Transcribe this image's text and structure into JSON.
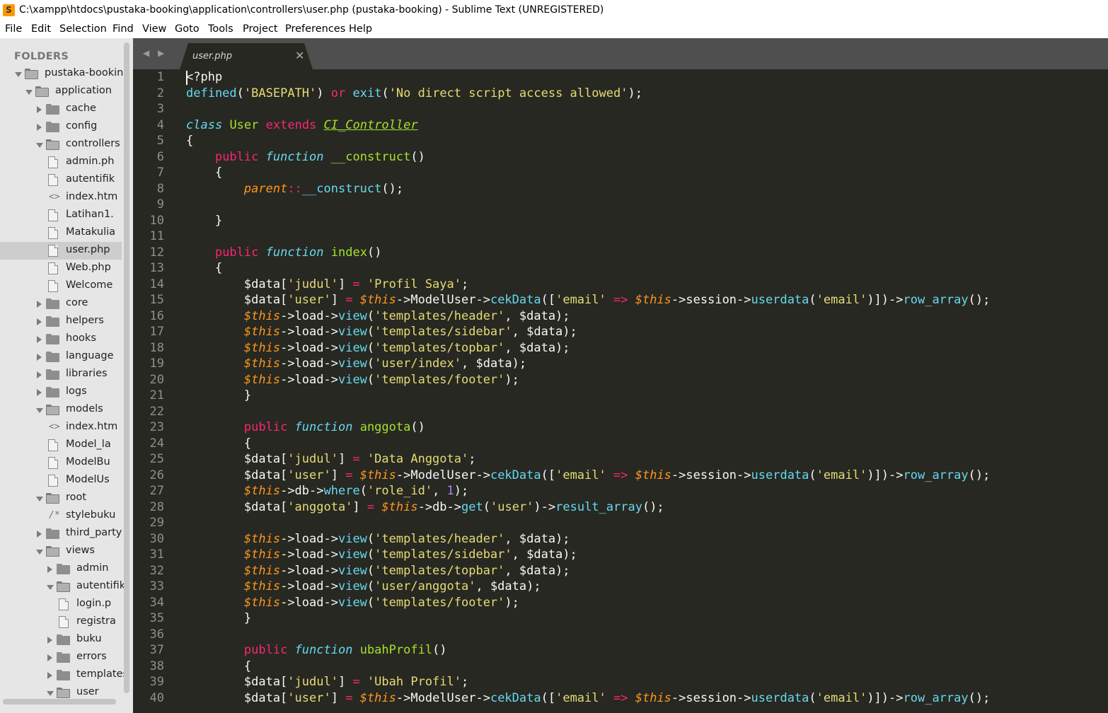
{
  "window": {
    "title": "C:\\xampp\\htdocs\\pustaka-booking\\application\\controllers\\user.php (pustaka-booking) - Sublime Text (UNREGISTERED)"
  },
  "menu": [
    "File",
    "Edit",
    "Selection",
    "Find",
    "View",
    "Goto",
    "Tools",
    "Project",
    "Preferences",
    "Help"
  ],
  "sidebar": {
    "header": "FOLDERS",
    "tree": [
      {
        "label": "pustaka-booking",
        "type": "folder",
        "expanded": true,
        "depth": 0
      },
      {
        "label": "application",
        "type": "folder",
        "expanded": true,
        "depth": 1
      },
      {
        "label": "cache",
        "type": "folder",
        "expanded": false,
        "depth": 2
      },
      {
        "label": "config",
        "type": "folder",
        "expanded": false,
        "depth": 2
      },
      {
        "label": "controllers",
        "type": "folder",
        "expanded": true,
        "depth": 2
      },
      {
        "label": "admin.ph",
        "type": "file",
        "depth": 3
      },
      {
        "label": "autentifik",
        "type": "file",
        "depth": 3
      },
      {
        "label": "index.htm",
        "type": "html",
        "depth": 3
      },
      {
        "label": "Latihan1.",
        "type": "file",
        "depth": 3
      },
      {
        "label": "Matakulia",
        "type": "file",
        "depth": 3
      },
      {
        "label": "user.php",
        "type": "file",
        "depth": 3,
        "selected": true
      },
      {
        "label": "Web.php",
        "type": "file",
        "depth": 3
      },
      {
        "label": "Welcome",
        "type": "file",
        "depth": 3
      },
      {
        "label": "core",
        "type": "folder",
        "expanded": false,
        "depth": 2
      },
      {
        "label": "helpers",
        "type": "folder",
        "expanded": false,
        "depth": 2
      },
      {
        "label": "hooks",
        "type": "folder",
        "expanded": false,
        "depth": 2
      },
      {
        "label": "language",
        "type": "folder",
        "expanded": false,
        "depth": 2
      },
      {
        "label": "libraries",
        "type": "folder",
        "expanded": false,
        "depth": 2
      },
      {
        "label": "logs",
        "type": "folder",
        "expanded": false,
        "depth": 2
      },
      {
        "label": "models",
        "type": "folder",
        "expanded": true,
        "depth": 2
      },
      {
        "label": "index.htm",
        "type": "html",
        "depth": 3
      },
      {
        "label": "Model_la",
        "type": "file",
        "depth": 3
      },
      {
        "label": "ModelBu",
        "type": "file",
        "depth": 3
      },
      {
        "label": "ModelUs",
        "type": "file",
        "depth": 3
      },
      {
        "label": "root",
        "type": "folder",
        "expanded": true,
        "depth": 2
      },
      {
        "label": "stylebuku",
        "type": "css",
        "depth": 3
      },
      {
        "label": "third_party",
        "type": "folder",
        "expanded": false,
        "depth": 2
      },
      {
        "label": "views",
        "type": "folder",
        "expanded": true,
        "depth": 2
      },
      {
        "label": "admin",
        "type": "folder",
        "expanded": false,
        "depth": 3
      },
      {
        "label": "autentifik",
        "type": "folder",
        "expanded": true,
        "depth": 3
      },
      {
        "label": "login.p",
        "type": "file",
        "depth": 4
      },
      {
        "label": "registra",
        "type": "file",
        "depth": 4
      },
      {
        "label": "buku",
        "type": "folder",
        "expanded": false,
        "depth": 3
      },
      {
        "label": "errors",
        "type": "folder",
        "expanded": false,
        "depth": 3
      },
      {
        "label": "templates",
        "type": "folder",
        "expanded": false,
        "depth": 3
      },
      {
        "label": "user",
        "type": "folder",
        "expanded": true,
        "depth": 3
      }
    ]
  },
  "tabs": [
    {
      "label": "user.php",
      "active": true
    }
  ],
  "editor": {
    "lines": [
      [
        [
          "p",
          "<?php"
        ]
      ],
      [
        [
          "f",
          "defined"
        ],
        [
          "p",
          "("
        ],
        [
          "s",
          "'BASEPATH'"
        ],
        [
          "p",
          ") "
        ],
        [
          "k",
          "or"
        ],
        [
          "p",
          " "
        ],
        [
          "f",
          "exit"
        ],
        [
          "p",
          "("
        ],
        [
          "s",
          "'No direct script access allowed'"
        ],
        [
          "p",
          ");"
        ]
      ],
      [],
      [
        [
          "sk",
          "class"
        ],
        [
          "p",
          " "
        ],
        [
          "cls",
          "User"
        ],
        [
          "p",
          " "
        ],
        [
          "k",
          "extends"
        ],
        [
          "p",
          " "
        ],
        [
          "inh",
          "CI_Controller"
        ]
      ],
      [
        [
          "p",
          "{"
        ]
      ],
      [
        [
          "p",
          "    "
        ],
        [
          "k",
          "public"
        ],
        [
          "p",
          " "
        ],
        [
          "sk",
          "function"
        ],
        [
          "p",
          " "
        ],
        [
          "cls",
          "__construct"
        ],
        [
          "p",
          "()"
        ]
      ],
      [
        [
          "p",
          "    {"
        ]
      ],
      [
        [
          "p",
          "        "
        ],
        [
          "v",
          "parent"
        ],
        [
          "k",
          "::"
        ],
        [
          "f",
          "__construct"
        ],
        [
          "p",
          "();"
        ]
      ],
      [],
      [
        [
          "p",
          "    }"
        ]
      ],
      [],
      [
        [
          "p",
          "    "
        ],
        [
          "k",
          "public"
        ],
        [
          "p",
          " "
        ],
        [
          "sk",
          "function"
        ],
        [
          "p",
          " "
        ],
        [
          "cls",
          "index"
        ],
        [
          "p",
          "()"
        ]
      ],
      [
        [
          "p",
          "    {"
        ]
      ],
      [
        [
          "p",
          "        $data["
        ],
        [
          "s",
          "'judul'"
        ],
        [
          "p",
          "] "
        ],
        [
          "k",
          "="
        ],
        [
          "p",
          " "
        ],
        [
          "s",
          "'Profil Saya'"
        ],
        [
          "p",
          ";"
        ]
      ],
      [
        [
          "p",
          "        $data["
        ],
        [
          "s",
          "'user'"
        ],
        [
          "p",
          "] "
        ],
        [
          "k",
          "="
        ],
        [
          "p",
          " "
        ],
        [
          "v",
          "$this"
        ],
        [
          "p",
          "->ModelUser->"
        ],
        [
          "f",
          "cekData"
        ],
        [
          "p",
          "(["
        ],
        [
          "s",
          "'email'"
        ],
        [
          "p",
          " "
        ],
        [
          "k",
          "=>"
        ],
        [
          "p",
          " "
        ],
        [
          "v",
          "$this"
        ],
        [
          "p",
          "->session->"
        ],
        [
          "f",
          "userdata"
        ],
        [
          "p",
          "("
        ],
        [
          "s",
          "'email'"
        ],
        [
          "p",
          ")])->"
        ],
        [
          "f",
          "row_array"
        ],
        [
          "p",
          "();"
        ]
      ],
      [
        [
          "p",
          "        "
        ],
        [
          "v",
          "$this"
        ],
        [
          "p",
          "->load->"
        ],
        [
          "f",
          "view"
        ],
        [
          "p",
          "("
        ],
        [
          "s",
          "'templates/header'"
        ],
        [
          "p",
          ", $data);"
        ]
      ],
      [
        [
          "p",
          "        "
        ],
        [
          "v",
          "$this"
        ],
        [
          "p",
          "->load->"
        ],
        [
          "f",
          "view"
        ],
        [
          "p",
          "("
        ],
        [
          "s",
          "'templates/sidebar'"
        ],
        [
          "p",
          ", $data);"
        ]
      ],
      [
        [
          "p",
          "        "
        ],
        [
          "v",
          "$this"
        ],
        [
          "p",
          "->load->"
        ],
        [
          "f",
          "view"
        ],
        [
          "p",
          "("
        ],
        [
          "s",
          "'templates/topbar'"
        ],
        [
          "p",
          ", $data);"
        ]
      ],
      [
        [
          "p",
          "        "
        ],
        [
          "v",
          "$this"
        ],
        [
          "p",
          "->load->"
        ],
        [
          "f",
          "view"
        ],
        [
          "p",
          "("
        ],
        [
          "s",
          "'user/index'"
        ],
        [
          "p",
          ", $data);"
        ]
      ],
      [
        [
          "p",
          "        "
        ],
        [
          "v",
          "$this"
        ],
        [
          "p",
          "->load->"
        ],
        [
          "f",
          "view"
        ],
        [
          "p",
          "("
        ],
        [
          "s",
          "'templates/footer'"
        ],
        [
          "p",
          ");"
        ]
      ],
      [
        [
          "p",
          "        }"
        ]
      ],
      [],
      [
        [
          "p",
          "        "
        ],
        [
          "k",
          "public"
        ],
        [
          "p",
          " "
        ],
        [
          "sk",
          "function"
        ],
        [
          "p",
          " "
        ],
        [
          "cls",
          "anggota"
        ],
        [
          "p",
          "()"
        ]
      ],
      [
        [
          "p",
          "        {"
        ]
      ],
      [
        [
          "p",
          "        $data["
        ],
        [
          "s",
          "'judul'"
        ],
        [
          "p",
          "] "
        ],
        [
          "k",
          "="
        ],
        [
          "p",
          " "
        ],
        [
          "s",
          "'Data Anggota'"
        ],
        [
          "p",
          ";"
        ]
      ],
      [
        [
          "p",
          "        $data["
        ],
        [
          "s",
          "'user'"
        ],
        [
          "p",
          "] "
        ],
        [
          "k",
          "="
        ],
        [
          "p",
          " "
        ],
        [
          "v",
          "$this"
        ],
        [
          "p",
          "->ModelUser->"
        ],
        [
          "f",
          "cekData"
        ],
        [
          "p",
          "(["
        ],
        [
          "s",
          "'email'"
        ],
        [
          "p",
          " "
        ],
        [
          "k",
          "=>"
        ],
        [
          "p",
          " "
        ],
        [
          "v",
          "$this"
        ],
        [
          "p",
          "->session->"
        ],
        [
          "f",
          "userdata"
        ],
        [
          "p",
          "("
        ],
        [
          "s",
          "'email'"
        ],
        [
          "p",
          ")])->"
        ],
        [
          "f",
          "row_array"
        ],
        [
          "p",
          "();"
        ]
      ],
      [
        [
          "p",
          "        "
        ],
        [
          "v",
          "$this"
        ],
        [
          "p",
          "->db->"
        ],
        [
          "f",
          "where"
        ],
        [
          "p",
          "("
        ],
        [
          "s",
          "'role_id'"
        ],
        [
          "p",
          ", "
        ],
        [
          "n",
          "1"
        ],
        [
          "p",
          ");"
        ]
      ],
      [
        [
          "p",
          "        $data["
        ],
        [
          "s",
          "'anggota'"
        ],
        [
          "p",
          "] "
        ],
        [
          "k",
          "="
        ],
        [
          "p",
          " "
        ],
        [
          "v",
          "$this"
        ],
        [
          "p",
          "->db->"
        ],
        [
          "f",
          "get"
        ],
        [
          "p",
          "("
        ],
        [
          "s",
          "'user'"
        ],
        [
          "p",
          ")->"
        ],
        [
          "f",
          "result_array"
        ],
        [
          "p",
          "();"
        ]
      ],
      [],
      [
        [
          "p",
          "        "
        ],
        [
          "v",
          "$this"
        ],
        [
          "p",
          "->load->"
        ],
        [
          "f",
          "view"
        ],
        [
          "p",
          "("
        ],
        [
          "s",
          "'templates/header'"
        ],
        [
          "p",
          ", $data);"
        ]
      ],
      [
        [
          "p",
          "        "
        ],
        [
          "v",
          "$this"
        ],
        [
          "p",
          "->load->"
        ],
        [
          "f",
          "view"
        ],
        [
          "p",
          "("
        ],
        [
          "s",
          "'templates/sidebar'"
        ],
        [
          "p",
          ", $data);"
        ]
      ],
      [
        [
          "p",
          "        "
        ],
        [
          "v",
          "$this"
        ],
        [
          "p",
          "->load->"
        ],
        [
          "f",
          "view"
        ],
        [
          "p",
          "("
        ],
        [
          "s",
          "'templates/topbar'"
        ],
        [
          "p",
          ", $data);"
        ]
      ],
      [
        [
          "p",
          "        "
        ],
        [
          "v",
          "$this"
        ],
        [
          "p",
          "->load->"
        ],
        [
          "f",
          "view"
        ],
        [
          "p",
          "("
        ],
        [
          "s",
          "'user/anggota'"
        ],
        [
          "p",
          ", $data);"
        ]
      ],
      [
        [
          "p",
          "        "
        ],
        [
          "v",
          "$this"
        ],
        [
          "p",
          "->load->"
        ],
        [
          "f",
          "view"
        ],
        [
          "p",
          "("
        ],
        [
          "s",
          "'templates/footer'"
        ],
        [
          "p",
          ");"
        ]
      ],
      [
        [
          "p",
          "        }"
        ]
      ],
      [],
      [
        [
          "p",
          "        "
        ],
        [
          "k",
          "public"
        ],
        [
          "p",
          " "
        ],
        [
          "sk",
          "function"
        ],
        [
          "p",
          " "
        ],
        [
          "cls",
          "ubahProfil"
        ],
        [
          "p",
          "()"
        ]
      ],
      [
        [
          "p",
          "        {"
        ]
      ],
      [
        [
          "p",
          "        $data["
        ],
        [
          "s",
          "'judul'"
        ],
        [
          "p",
          "] "
        ],
        [
          "k",
          "="
        ],
        [
          "p",
          " "
        ],
        [
          "s",
          "'Ubah Profil'"
        ],
        [
          "p",
          ";"
        ]
      ],
      [
        [
          "p",
          "        $data["
        ],
        [
          "s",
          "'user'"
        ],
        [
          "p",
          "] "
        ],
        [
          "k",
          "="
        ],
        [
          "p",
          " "
        ],
        [
          "v",
          "$this"
        ],
        [
          "p",
          "->ModelUser->"
        ],
        [
          "f",
          "cekData"
        ],
        [
          "p",
          "(["
        ],
        [
          "s",
          "'email'"
        ],
        [
          "p",
          " "
        ],
        [
          "k",
          "=>"
        ],
        [
          "p",
          " "
        ],
        [
          "v",
          "$this"
        ],
        [
          "p",
          "->session->"
        ],
        [
          "f",
          "userdata"
        ],
        [
          "p",
          "("
        ],
        [
          "s",
          "'email'"
        ],
        [
          "p",
          ")])->"
        ],
        [
          "f",
          "row_array"
        ],
        [
          "p",
          "();"
        ]
      ]
    ],
    "line_numbers": [
      "1",
      "2",
      "3",
      "4",
      "5",
      "6",
      "7",
      "8",
      "9",
      "10",
      "11",
      "12",
      "13",
      "14",
      "15",
      "16",
      "17",
      "18",
      "19",
      "20",
      "21",
      "22",
      "23",
      "24",
      "25",
      "26",
      "27",
      "28",
      "29",
      "30",
      "31",
      "32",
      "33",
      "34",
      "35",
      "36",
      "37",
      "38",
      "39",
      "40"
    ]
  },
  "colors": {
    "editor_bg": "#272822",
    "keyword": "#f92672",
    "storage": "#66d9ef",
    "string": "#e6db74",
    "entity": "#a6e22e",
    "variable": "#fd971f",
    "number": "#ae81ff"
  }
}
